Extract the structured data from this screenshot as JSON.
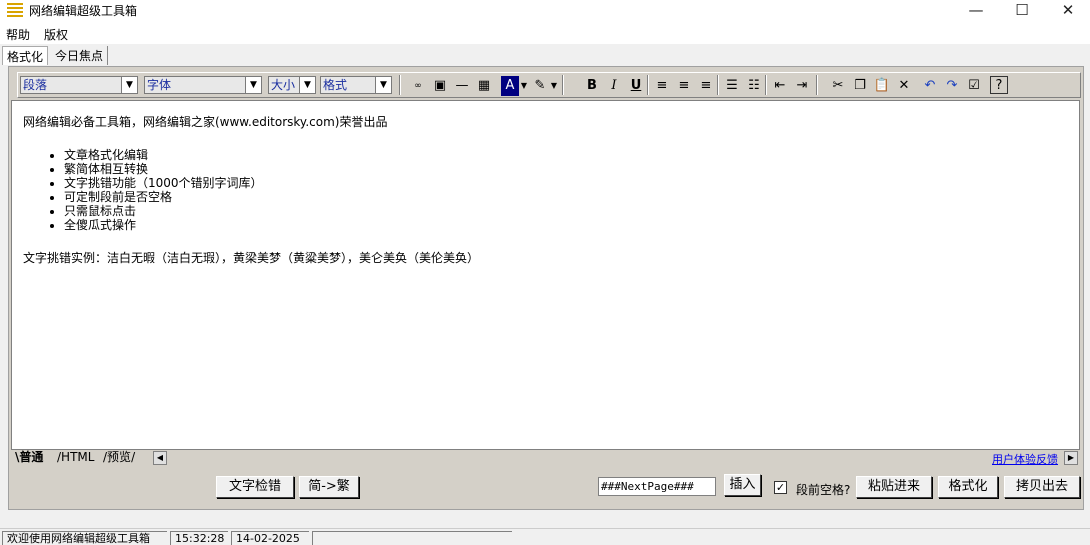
{
  "window": {
    "title": "网络编辑超级工具箱",
    "minimize": "—",
    "maximize": "☐",
    "close": "✕"
  },
  "menu": [
    "帮助",
    "版权"
  ],
  "top_tabs": [
    "格式化",
    "今日焦点"
  ],
  "toolbar": {
    "paragraph_select": "段落",
    "font_select": "字体",
    "size_select": "大小",
    "format_select": "格式",
    "bold": "B",
    "italic": "I",
    "underline": "U"
  },
  "editor": {
    "intro": "网络编辑必备工具箱，网络编辑之家(www.editorsky.com)荣誉出品",
    "features": [
      "文章格式化编辑",
      "繁简体相互转换",
      "文字挑错功能（1000个错别字词库）",
      "可定制段前是否空格",
      "只需鼠标点击",
      "全傻瓜式操作"
    ],
    "example": "文字挑错实例：洁白无暇（洁白无瑕），黄梁美梦（黄粱美梦），美仑美奂（美伦美奂）"
  },
  "bottom_tabs": [
    "普通",
    "HTML",
    "预览"
  ],
  "feedback_link": "用户体验反馈",
  "actions": {
    "spellcheck": "文字检错",
    "convert": "简->繁",
    "nextpage_value": "###NextPage###",
    "insert": "插入",
    "indent_label": "段前空格?",
    "indent_checked": true,
    "paste": "粘贴进来",
    "format": "格式化",
    "copy_out": "拷贝出去"
  },
  "status": {
    "welcome": "欢迎使用网络编辑超级工具箱",
    "time": "15:32:28",
    "date": "14-02-2025"
  }
}
